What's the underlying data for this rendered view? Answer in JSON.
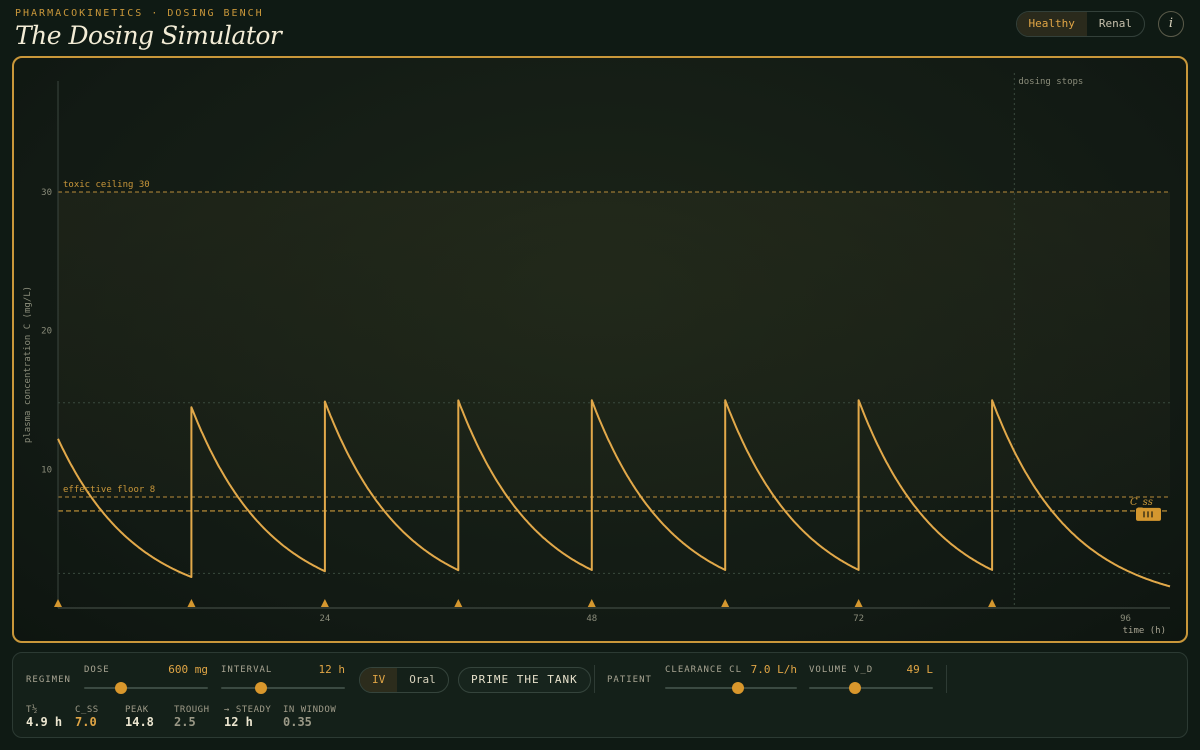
{
  "header": {
    "eyebrow": "PHARMACOKINETICS · DOSING BENCH",
    "title": "The Dosing Simulator",
    "modes": [
      "Healthy",
      "Renal"
    ],
    "active_mode": "Healthy",
    "info_icon": "i"
  },
  "chart_data": {
    "type": "line",
    "xlabel": "time (h)",
    "ylabel": "plasma concentration  C (mg/L)",
    "xlim": [
      0,
      100
    ],
    "ylim": [
      0,
      38
    ],
    "x_ticks": [
      24,
      48,
      72,
      96
    ],
    "y_ticks": [
      10,
      20,
      30
    ],
    "reference_lines": [
      {
        "label": "toxic ceiling  30",
        "y": 30
      },
      {
        "label": "effective floor  8",
        "y": 8
      }
    ],
    "css_label": "C_ss",
    "css_value": 7.0,
    "css_handle_icon": "grip-icon",
    "dosing_stop_label": "dosing stops",
    "dosing_stop_time": 86,
    "dose_times": [
      0,
      12,
      24,
      36,
      48,
      60,
      72,
      84
    ],
    "peak_guide": 14.8,
    "trough_guide": 2.5,
    "half_life_h": 4.9,
    "initial_conc": 12.2,
    "dose_increment": 12.24,
    "grid": true
  },
  "controls": {
    "regimen_label": "REGIMEN",
    "dose": {
      "label": "DOSE",
      "value": "600 mg",
      "fraction": 0.3
    },
    "interval": {
      "label": "INTERVAL",
      "value": "12 h",
      "fraction": 0.32
    },
    "route": {
      "options": [
        "IV",
        "Oral"
      ],
      "active": "IV"
    },
    "prime_label": "PRIME THE TANK",
    "patient_label": "PATIENT",
    "clearance": {
      "label": "CLEARANCE CL",
      "value": "7.0 L/h",
      "fraction": 0.55
    },
    "volume": {
      "label": "VOLUME V_D",
      "value": "49 L",
      "fraction": 0.37
    },
    "stats": [
      {
        "label": "T½",
        "value": "4.9 h",
        "color": "#ece6d0"
      },
      {
        "label": "C_SS",
        "value": "7.0",
        "color": "#e0a545"
      },
      {
        "label": "PEAK",
        "value": "14.8",
        "color": "#ece6d0"
      },
      {
        "label": "TROUGH",
        "value": "2.5",
        "color": "#9a9886"
      },
      {
        "label": "→ STEADY",
        "value": "12 h",
        "color": "#ece6d0"
      },
      {
        "label": "IN WINDOW",
        "value": "0.35",
        "color": "#9a9886"
      }
    ]
  }
}
